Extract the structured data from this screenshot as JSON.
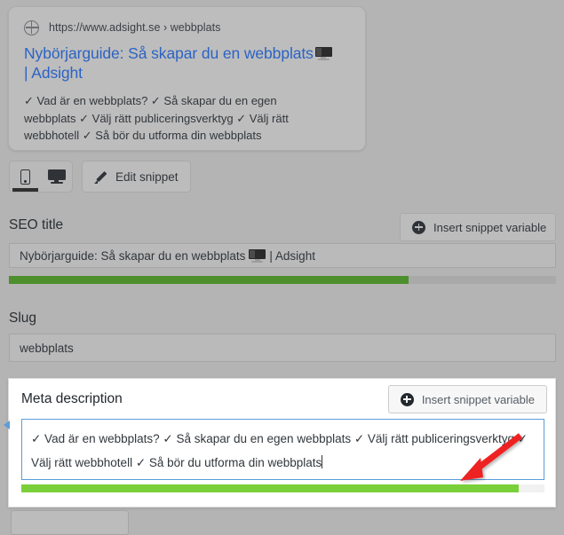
{
  "snippet_preview": {
    "url": "https://www.adsight.se › webbplats",
    "title_before_icon": "Nybörjarguide: Så skapar du en webbplats",
    "title_icon": "desktop-monitor-emoji",
    "title_after_icon": "| Adsight",
    "description": "✓ Vad är en webbplats? ✓ Så skapar du en egen webbplats ✓ Välj rätt publiceringsverktyg ✓ Välj rätt webbhotell ✓ Så bör du utforma din webbplats"
  },
  "controls": {
    "mobile_icon": "mobile-phone-icon",
    "desktop_icon": "desktop-monitor-icon",
    "active_device": "mobile",
    "edit_snippet_label": "Edit snippet",
    "edit_snippet_icon": "pencil-icon"
  },
  "seo_title": {
    "label": "SEO title",
    "insert_button_label": "Insert snippet variable",
    "insert_button_icon": "plus-circle-icon",
    "value_before_icon": "Nybörjarguide: Så skapar du en webbplats",
    "value_icon": "desktop-monitor-emoji",
    "value_after_icon": "| Adsight",
    "progress_percent": 73,
    "progress_color": "#4d8f2d"
  },
  "slug": {
    "label": "Slug",
    "value": "webbplats"
  },
  "meta_description": {
    "label": "Meta description",
    "insert_button_label": "Insert snippet variable",
    "insert_button_icon": "plus-circle-icon",
    "line1": "✓ Vad är en webbplats? ✓ Så skapar du en egen webbplats ✓ Välj rätt publiceringsverktyg ✓",
    "line2": "Välj rätt webbhotell ✓ Så bör du utforma din webbplats",
    "progress_percent": 95,
    "progress_color": "#7ad03a"
  },
  "annotation": {
    "arrow_color": "#ee2222",
    "arrow_points_to": "meta-description-progress-bar"
  }
}
